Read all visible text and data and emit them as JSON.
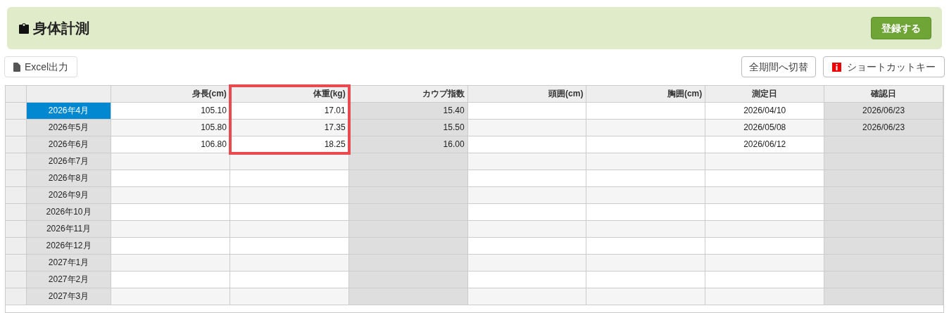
{
  "header": {
    "title": "身体計測",
    "submit": "登録する"
  },
  "toolbar": {
    "export": "Excel出力",
    "period_toggle": "全期間へ切替",
    "shortcuts": "ショートカットキー"
  },
  "table": {
    "columns": [
      {
        "label": "身長(cm)",
        "kind": "number_input",
        "highlighted": false
      },
      {
        "label": "体重(kg)",
        "kind": "number_input",
        "highlighted": true
      },
      {
        "label": "カウプ指数",
        "kind": "number_calc",
        "highlighted": false
      },
      {
        "label": "頭囲(cm)",
        "kind": "number_input",
        "highlighted": false
      },
      {
        "label": "胸囲(cm)",
        "kind": "number_input",
        "highlighted": false
      },
      {
        "label": "測定日",
        "kind": "date_input",
        "highlighted": false
      },
      {
        "label": "確認日",
        "kind": "date_calc",
        "highlighted": false
      }
    ],
    "rows": [
      {
        "month": "2026年4月",
        "selected": true,
        "values": {
          "column_1": "105.10",
          "column_2": "17.01",
          "column_3": "15.40",
          "column_6": "2026/04/10",
          "column_7": "2026/06/23"
        }
      },
      {
        "month": "2026年5月",
        "selected": false,
        "values": {
          "column_1": "105.80",
          "column_2": "17.35",
          "column_3": "15.50",
          "column_6": "2026/05/08",
          "column_7": "2026/06/23"
        }
      },
      {
        "month": "2026年6月",
        "selected": false,
        "values": {
          "column_1": "106.80",
          "column_2": "18.25",
          "column_3": "16.00",
          "column_6": "2026/06/12"
        }
      },
      {
        "month": "2026年7月",
        "selected": false
      },
      {
        "month": "2026年8月",
        "selected": false
      },
      {
        "month": "2026年9月",
        "selected": false
      },
      {
        "month": "2026年10月",
        "selected": false
      },
      {
        "month": "2026年11月",
        "selected": false
      },
      {
        "month": "2026年12月",
        "selected": false
      },
      {
        "month": "2027年1月",
        "selected": false
      },
      {
        "month": "2027年2月",
        "selected": false
      },
      {
        "month": "2027年3月",
        "selected": false
      }
    ]
  }
}
